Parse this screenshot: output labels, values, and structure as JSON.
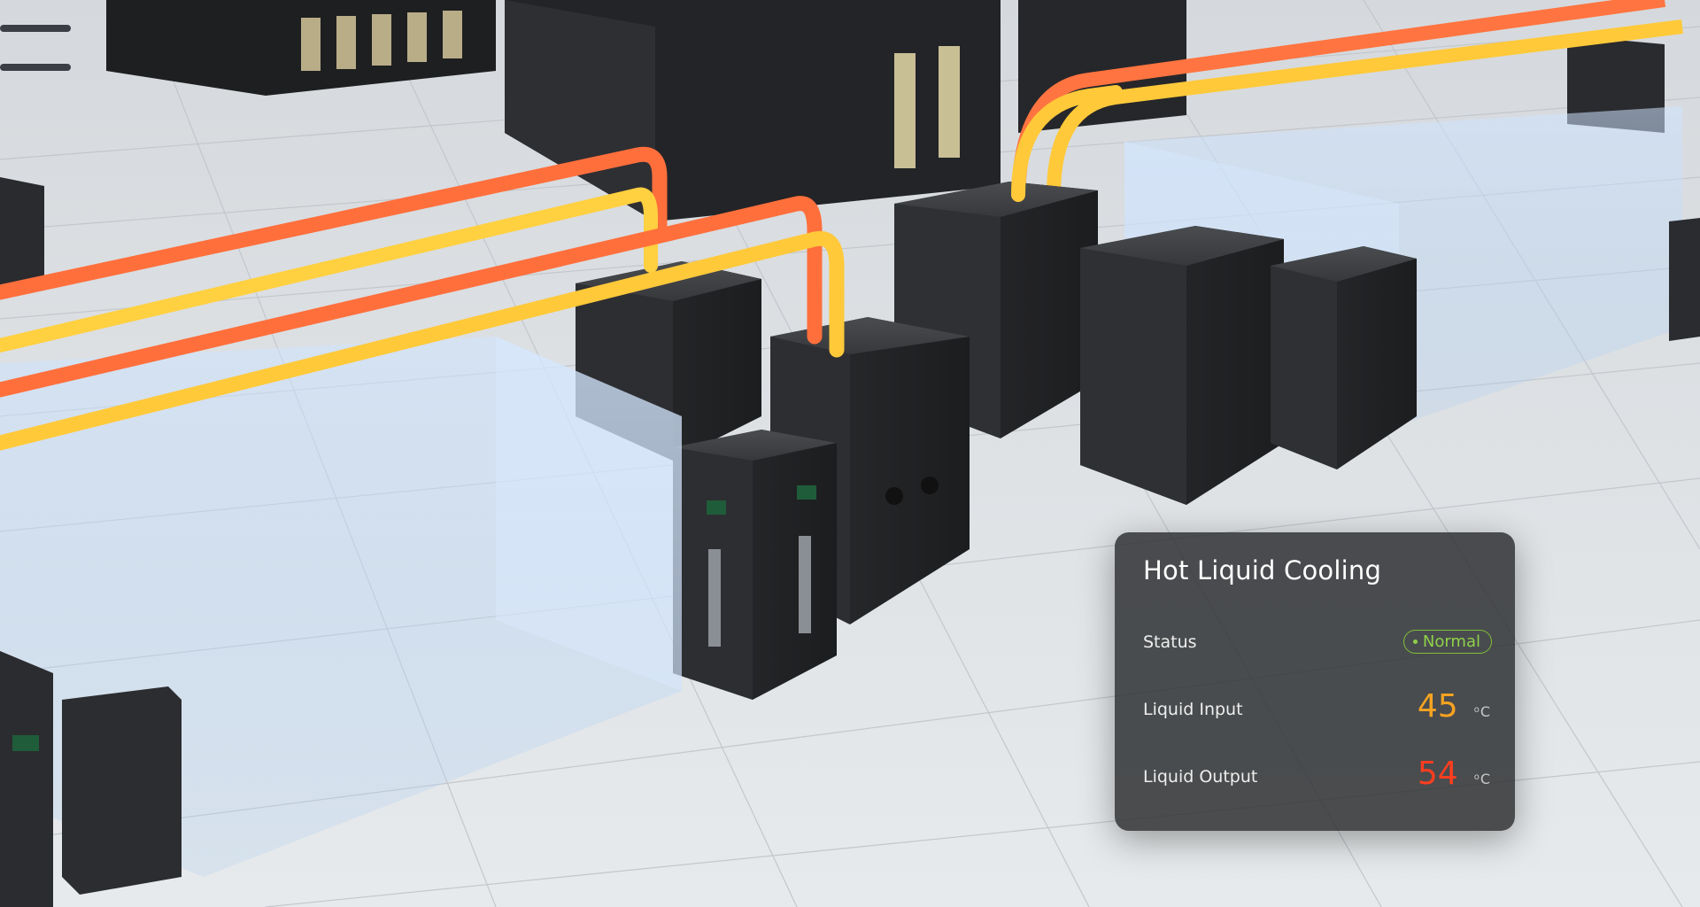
{
  "panel": {
    "title": "Hot Liquid Cooling",
    "status_label": "Status",
    "status_value": "Normal",
    "input_label": "Liquid Input",
    "input_value": "45",
    "input_unit": "C",
    "output_label": "Liquid Output",
    "output_value": "54",
    "output_unit": "C"
  },
  "colors": {
    "status_green": "#8fd14a",
    "input_orange": "#f6a321",
    "output_red": "#ff3d1f",
    "pipe_hot": "#ff6a3a",
    "pipe_warm": "#ffc42e"
  }
}
